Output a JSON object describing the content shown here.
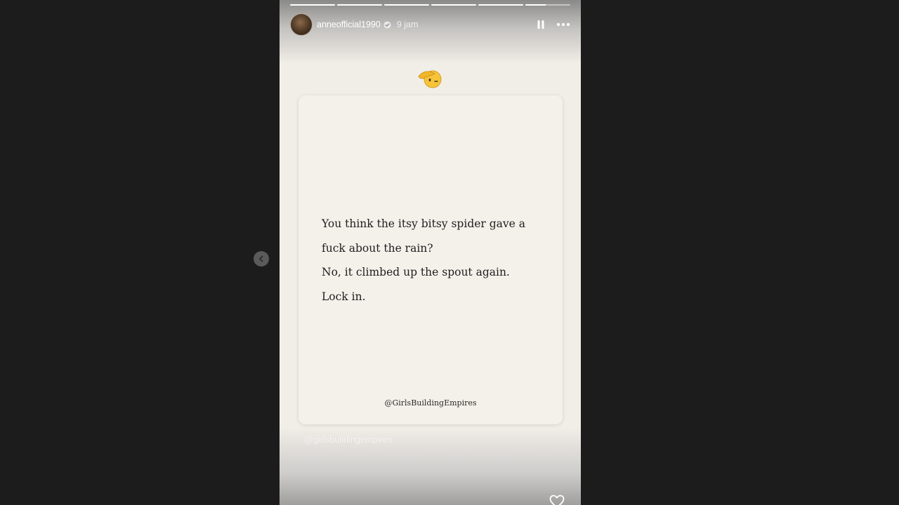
{
  "story": {
    "username": "anneofficial1990",
    "verified": true,
    "timestamp": "9 jam",
    "progress_segments": [
      1,
      1,
      1,
      1,
      1,
      0.45
    ],
    "emoji": "saluting-face",
    "quote_lines": [
      "You think the itsy bitsy spider gave a",
      "fuck about the rain?",
      "No, it climbed up the spout again.",
      "Lock in."
    ],
    "card_credit": "@GirlsBuildingEmpires",
    "mention_sticker": "@girlsbuildingempires"
  },
  "controls": {
    "pause_icon": "pause-icon",
    "more_icon": "more-options-icon",
    "prev_icon": "chevron-left-icon",
    "like_icon": "heart-icon"
  },
  "colors": {
    "page_background": "#1c1c1c",
    "story_background": "#f1ede7",
    "card_background": "#f4f0ea",
    "text": "#1e1e1e",
    "verified_badge": "#ffffff"
  }
}
